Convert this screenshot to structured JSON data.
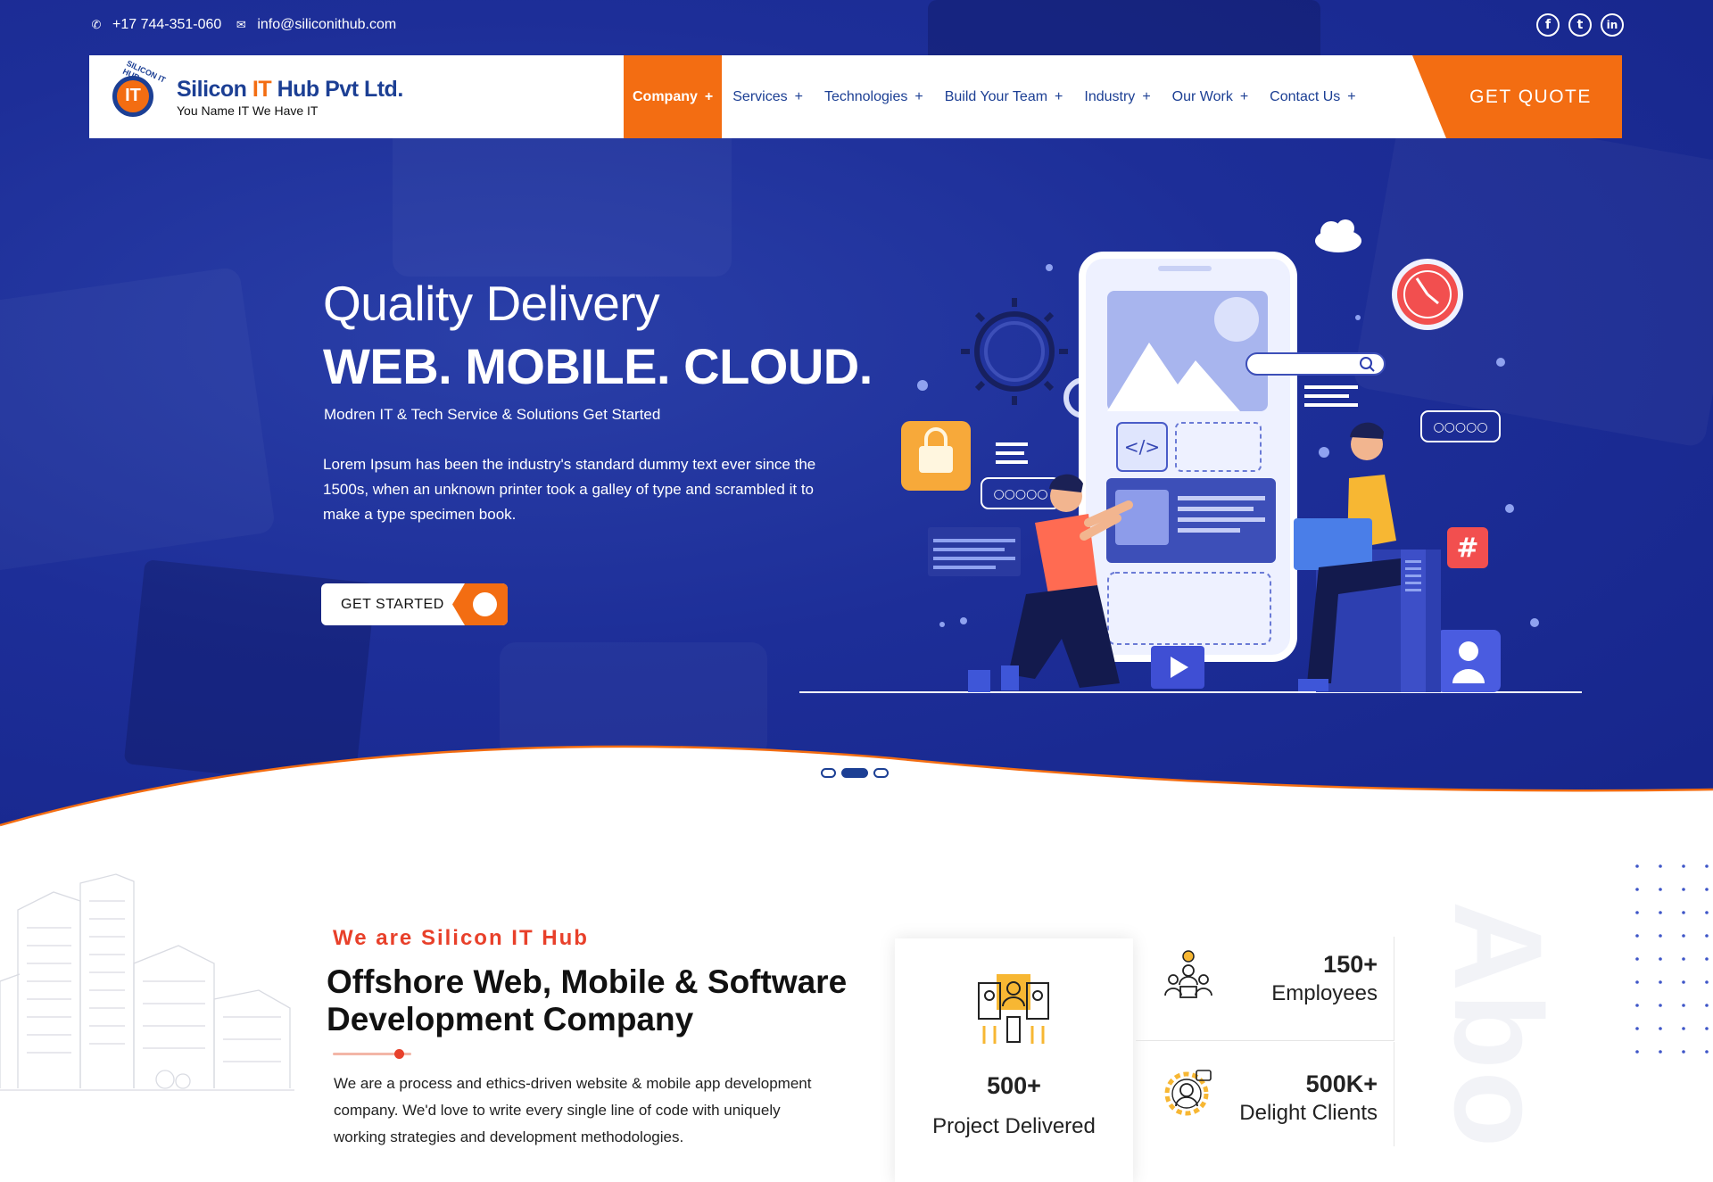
{
  "topbar": {
    "phone": "+17 744-351-060",
    "email": "info@siliconithub.com",
    "social_facebook": "f",
    "social_tumblr": "t",
    "social_linkedin": "in"
  },
  "brand": {
    "logo_mark_text": "IT",
    "logo_arc_text": "SILICON IT HUB",
    "name_part1": "Silicon ",
    "name_part2": "IT",
    "name_part3": " Hub Pvt Ltd.",
    "tagline": "You Name IT We Have IT"
  },
  "nav": {
    "items": [
      {
        "label": "Company",
        "plus": "+"
      },
      {
        "label": "Services",
        "plus": "+"
      },
      {
        "label": "Technologies",
        "plus": "+"
      },
      {
        "label": "Build Your Team",
        "plus": "+"
      },
      {
        "label": "Industry",
        "plus": "+"
      },
      {
        "label": "Our Work",
        "plus": "+"
      },
      {
        "label": "Contact Us",
        "plus": "+"
      }
    ],
    "quote_label": "GET QUOTE"
  },
  "hero": {
    "title": "Quality Delivery",
    "headline": "WEB. MOBILE. CLOUD.",
    "subtitle": "Modren IT & Tech Service & Solutions Get Started",
    "description": " Lorem Ipsum has been the industry's standard dummy text ever since the 1500s, when an unknown printer took a galley of type and scrambled it to make a type specimen book.",
    "cta_label": "GET STARTED",
    "slider_active_index": 1,
    "slider_count": 3
  },
  "about": {
    "kicker": "We are Silicon IT Hub",
    "title": "Offshore Web, Mobile & Software Development Company",
    "text": "We are a process and ethics-driven website & mobile app development company. We'd love to write every single line of code with uniquely working strategies and development methodologies.",
    "watermark": "Abo"
  },
  "stats": {
    "projects": {
      "num": "500+",
      "label": "Project Delivered"
    },
    "employees": {
      "num": "150+",
      "label": "Employees"
    },
    "clients": {
      "num": "500K+",
      "label": "Delight Clients"
    }
  },
  "colors": {
    "brand_blue": "#1c3f94",
    "accent_orange": "#f36d12",
    "hero_blue": "#1d2e98",
    "kicker_red": "#e8402a"
  }
}
